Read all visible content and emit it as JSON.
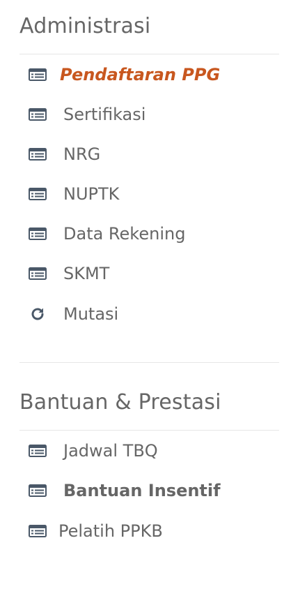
{
  "sections": [
    {
      "title": "Administrasi",
      "items": [
        {
          "label": "Pendaftaran PPG",
          "icon": "list-icon"
        },
        {
          "label": "Sertifikasi",
          "icon": "list-icon"
        },
        {
          "label": "NRG",
          "icon": "list-icon"
        },
        {
          "label": "NUPTK",
          "icon": "list-icon"
        },
        {
          "label": "Data Rekening",
          "icon": "list-icon"
        },
        {
          "label": "SKMT",
          "icon": "list-icon"
        },
        {
          "label": "Mutasi",
          "icon": "refresh-icon"
        }
      ]
    },
    {
      "title": "Bantuan & Prestasi",
      "items": [
        {
          "label": "Jadwal TBQ",
          "icon": "list-icon"
        },
        {
          "label": "Bantuan Insentif",
          "icon": "list-icon"
        },
        {
          "label": "Pelatih PPKB",
          "icon": "list-icon"
        }
      ]
    }
  ],
  "colors": {
    "active": "#c8571f",
    "text": "#666666",
    "icon": "#4a5868",
    "divider": "#e6e6e6"
  }
}
